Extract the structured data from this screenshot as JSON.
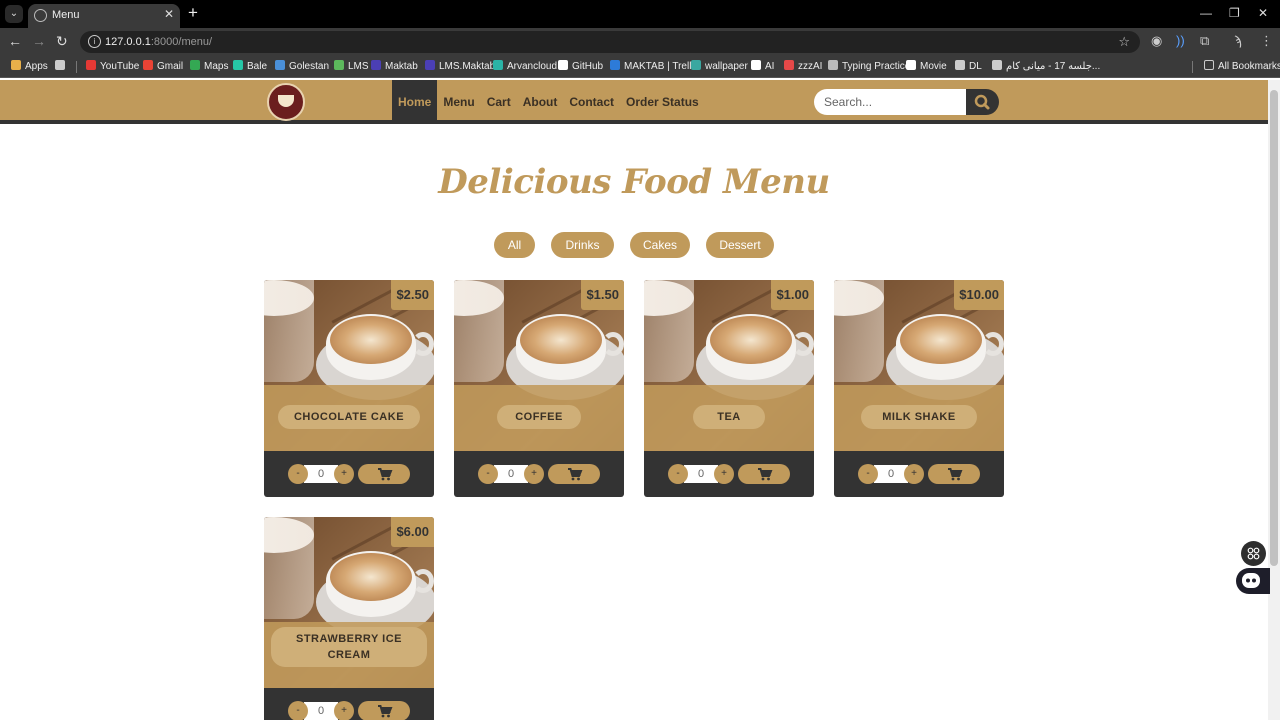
{
  "browser": {
    "tab_title": "Menu",
    "tab_close": "✕",
    "new_tab": "+",
    "url_host": "127.0.0.1",
    "url_path": ":8000/menu/",
    "bookmarks": [
      {
        "label": "Apps",
        "color": "#e8b04a"
      },
      {
        "label": "",
        "color": "#cccccc"
      },
      {
        "label": "YouTube",
        "color": "#e53935"
      },
      {
        "label": "Gmail",
        "color": "#ea4335"
      },
      {
        "label": "Maps",
        "color": "#34a853"
      },
      {
        "label": "Bale",
        "color": "#26c6a6"
      },
      {
        "label": "Golestan",
        "color": "#4a90d9"
      },
      {
        "label": "LMS",
        "color": "#5cb85c"
      },
      {
        "label": "Maktab",
        "color": "#4b3fb5"
      },
      {
        "label": "LMS.Maktab",
        "color": "#4b3fb5"
      },
      {
        "label": "Arvancloud",
        "color": "#2ab3a6"
      },
      {
        "label": "GitHub",
        "color": "#ffffff"
      },
      {
        "label": "MAKTAB | Trello",
        "color": "#2d7bd8"
      },
      {
        "label": "wallpaper",
        "color": "#3aa7a0"
      },
      {
        "label": "AI",
        "color": "#ffffff"
      },
      {
        "label": "zzzAI",
        "color": "#e54848"
      },
      {
        "label": "Typing Practice",
        "color": "#bbbbbb"
      },
      {
        "label": "Movie",
        "color": "#ffffff"
      },
      {
        "label": "DL",
        "color": "#cccccc"
      },
      {
        "label": "جلسه 17 - میانی کام...",
        "color": "#cccccc"
      }
    ],
    "all_bookmarks": "All Bookmarks"
  },
  "nav": {
    "links": [
      "Home",
      "Menu",
      "Cart",
      "About",
      "Contact",
      "Order Status"
    ],
    "active": "Home",
    "search_placeholder": "Search..."
  },
  "menu": {
    "title": "Delicious Food Menu",
    "filters": [
      "All",
      "Drinks",
      "Cakes",
      "Dessert"
    ],
    "items": [
      {
        "name": "CHOCOLATE CAKE",
        "price": "$2.50",
        "qty": "0"
      },
      {
        "name": "COFFEE",
        "price": "$1.50",
        "qty": "0"
      },
      {
        "name": "TEA",
        "price": "$1.00",
        "qty": "0"
      },
      {
        "name": "MILK SHAKE",
        "price": "$10.00",
        "qty": "0"
      },
      {
        "name": "STRAWBERRY ICE CREAM",
        "price": "$6.00",
        "qty": "0"
      }
    ],
    "qty_minus": "-",
    "qty_plus": "+"
  },
  "colors": {
    "accent": "#c09a5b",
    "dark": "#333333"
  }
}
